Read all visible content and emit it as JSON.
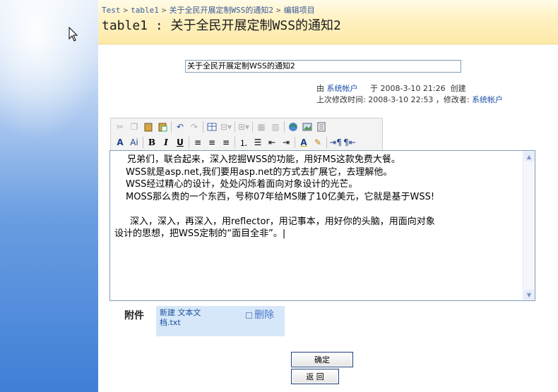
{
  "breadcrumb": {
    "items": [
      "Test",
      "table1",
      "关于全民开展定制WSS的通知2",
      "编辑项目"
    ],
    "separator": ">"
  },
  "page_title": "table1 : 关于全民开展定制WSS的通知2",
  "title_field": {
    "value": "关于全民开展定制WSS的通知2"
  },
  "meta": {
    "created_by_prefix": "由",
    "created_by": "系统帐户",
    "created_on_prefix": "于",
    "created_at": "2008-3-10 21:26",
    "created_suffix": "创建",
    "modified_label": "上次修改时间:",
    "modified_at": "2008-3-10 22:53",
    "modifier_label": "，修改者:",
    "modified_by": "系统帐户"
  },
  "editor": {
    "lines": [
      "兄弟们，联合起来，深入挖掘WSS的功能，用好MS这款免费大餐。",
      "WSS就是asp.net,我们要用asp.net的方式去扩展它，去理解他。",
      "WSS经过精心的设计，处处闪烁着面向对象设计的光芒。",
      "MOSS那么贵的一个东西，号称07年给MS赚了10亿美元，它就是基于WSS!",
      "",
      "深入，深入，再深入，用reflector，用记事本，用好你的头脑，用面向对象",
      "设计的思想，把WSS定制的“面目全非”。|"
    ]
  },
  "attachments": {
    "label": "附件",
    "file_name": "新建 文本文档.txt",
    "delete_label": "删除"
  },
  "buttons": {
    "ok": "确定",
    "back": "返 回"
  }
}
